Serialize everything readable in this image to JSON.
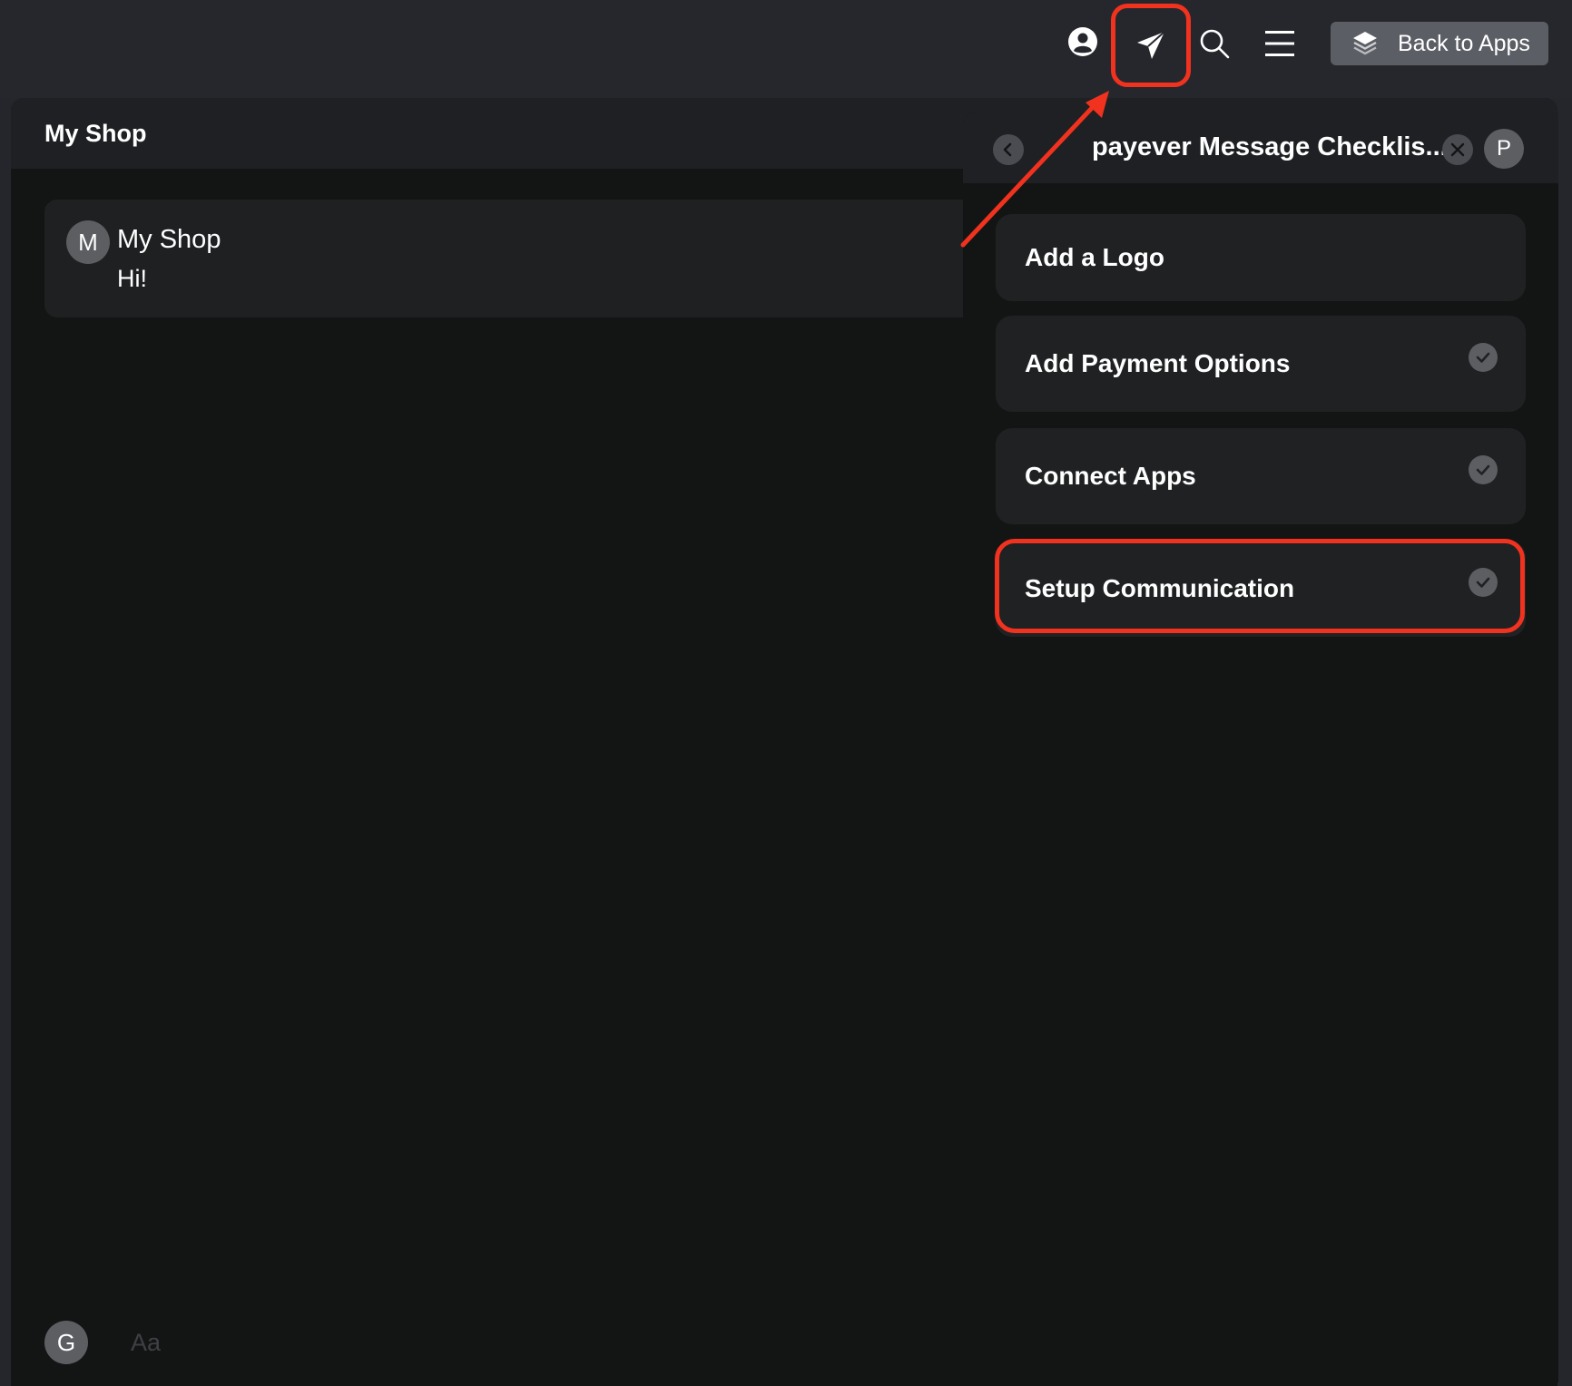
{
  "topbar": {
    "icons": {
      "profile": "profile-icon",
      "send": "send-icon",
      "search": "search-icon",
      "menu": "menu-icon",
      "apps": "layers-icon"
    },
    "back_to_apps_label": "Back to Apps"
  },
  "main": {
    "title": "My Shop",
    "chat": {
      "avatar_letter": "M",
      "name": "My Shop",
      "message": "Hi!"
    },
    "compose": {
      "avatar_letter": "G",
      "placeholder": "Aa"
    }
  },
  "checklist": {
    "title": "payever Message Checklis...",
    "avatar_letter": "P",
    "items": [
      {
        "label": "Add a Logo",
        "done": false
      },
      {
        "label": "Add Payment Options",
        "done": true
      },
      {
        "label": "Connect Apps",
        "done": true
      },
      {
        "label": "Setup Communication",
        "done": true
      }
    ]
  },
  "annotations": {
    "highlight_color": "#f0321e"
  },
  "colors": {
    "background": "#24262c",
    "panel": "#131515",
    "card": "#1f2123",
    "button": "#5b5e65"
  }
}
